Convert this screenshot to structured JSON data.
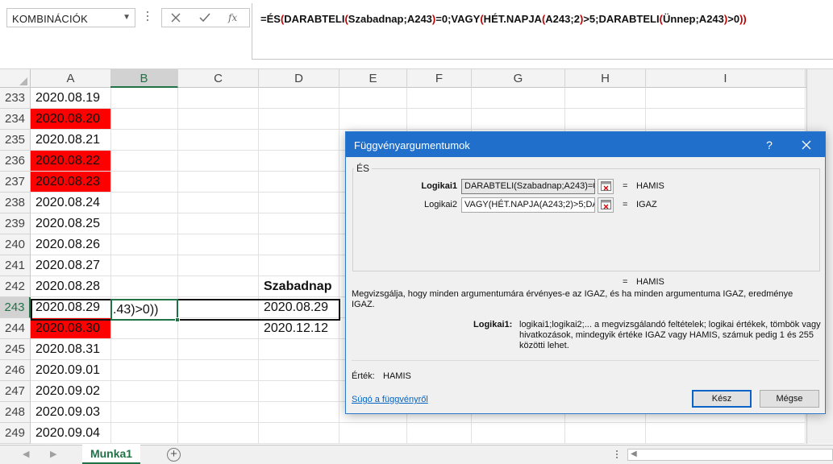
{
  "name_box": {
    "value": "KOMBINÁCIÓK"
  },
  "formula_bar": {
    "formula": "=ÉS(DARABTELI(Szabadnap;A243)=0;VAGY(HÉT.NAPJA(A243;2)>5;DARABTELI(Ünnep;A243)>0))"
  },
  "columns": [
    "A",
    "B",
    "C",
    "D",
    "E",
    "F",
    "G",
    "H",
    "I"
  ],
  "rows": [
    {
      "num": "233",
      "a": "2020.08.19",
      "a_red": false
    },
    {
      "num": "234",
      "a": "2020.08.20",
      "a_red": true
    },
    {
      "num": "235",
      "a": "2020.08.21",
      "a_red": false
    },
    {
      "num": "236",
      "a": "2020.08.22",
      "a_red": true
    },
    {
      "num": "237",
      "a": "2020.08.23",
      "a_red": true
    },
    {
      "num": "238",
      "a": "2020.08.24",
      "a_red": false
    },
    {
      "num": "239",
      "a": "2020.08.25",
      "a_red": false
    },
    {
      "num": "240",
      "a": "2020.08.26",
      "a_red": false
    },
    {
      "num": "241",
      "a": "2020.08.27",
      "a_red": false
    },
    {
      "num": "242",
      "a": "2020.08.28",
      "a_red": false,
      "d": "Szabadnap",
      "d_bold": true
    },
    {
      "num": "243",
      "a": "2020.08.29",
      "a_red": false,
      "d": "2020.08.29"
    },
    {
      "num": "244",
      "a": "2020.08.30",
      "a_red": true,
      "d": "2020.12.12"
    },
    {
      "num": "245",
      "a": "2020.08.31",
      "a_red": false
    },
    {
      "num": "246",
      "a": "2020.09.01",
      "a_red": false
    },
    {
      "num": "247",
      "a": "2020.09.02",
      "a_red": false
    },
    {
      "num": "248",
      "a": "2020.09.03",
      "a_red": false
    },
    {
      "num": "249",
      "a": "2020.09.04",
      "a_red": false
    }
  ],
  "active_cell": {
    "display": ".43)>0))"
  },
  "sheet_tab": {
    "label": "Munka1"
  },
  "dialog": {
    "title": "Függvényargumentumok",
    "help": "?",
    "function_name": "ÉS",
    "args": [
      {
        "label": "Logikai1",
        "value": "DARABTELI(Szabadnap;A243)=0",
        "result": "HAMIS"
      },
      {
        "label": "Logikai2",
        "value": "VAGY(HÉT.NAPJA(A243;2)>5;DARA",
        "result": "IGAZ"
      }
    ],
    "eq_sign": "=",
    "overall_result": "HAMIS",
    "description": "Megvizsgálja, hogy minden argumentumára érvényes-e az IGAZ, és ha minden argumentuma IGAZ, eredménye IGAZ.",
    "arg_desc_label": "Logikai1:",
    "arg_desc_text": "logikai1;logikai2;... a megvizsgálandó feltételek; logikai értékek, tömbök vagy hivatkozások, mindegyik értéke IGAZ vagy HAMIS, számuk pedig 1 és 255 közötti lehet.",
    "value_label": "Érték:",
    "value": "HAMIS",
    "help_link": "Súgó a függvényről",
    "ok_label": "Kész",
    "cancel_label": "Mégse"
  },
  "colors": {
    "accent": "#217346",
    "dialog_title": "#1f6fcb",
    "highlight": "#ff0000",
    "link": "#0563c1"
  }
}
